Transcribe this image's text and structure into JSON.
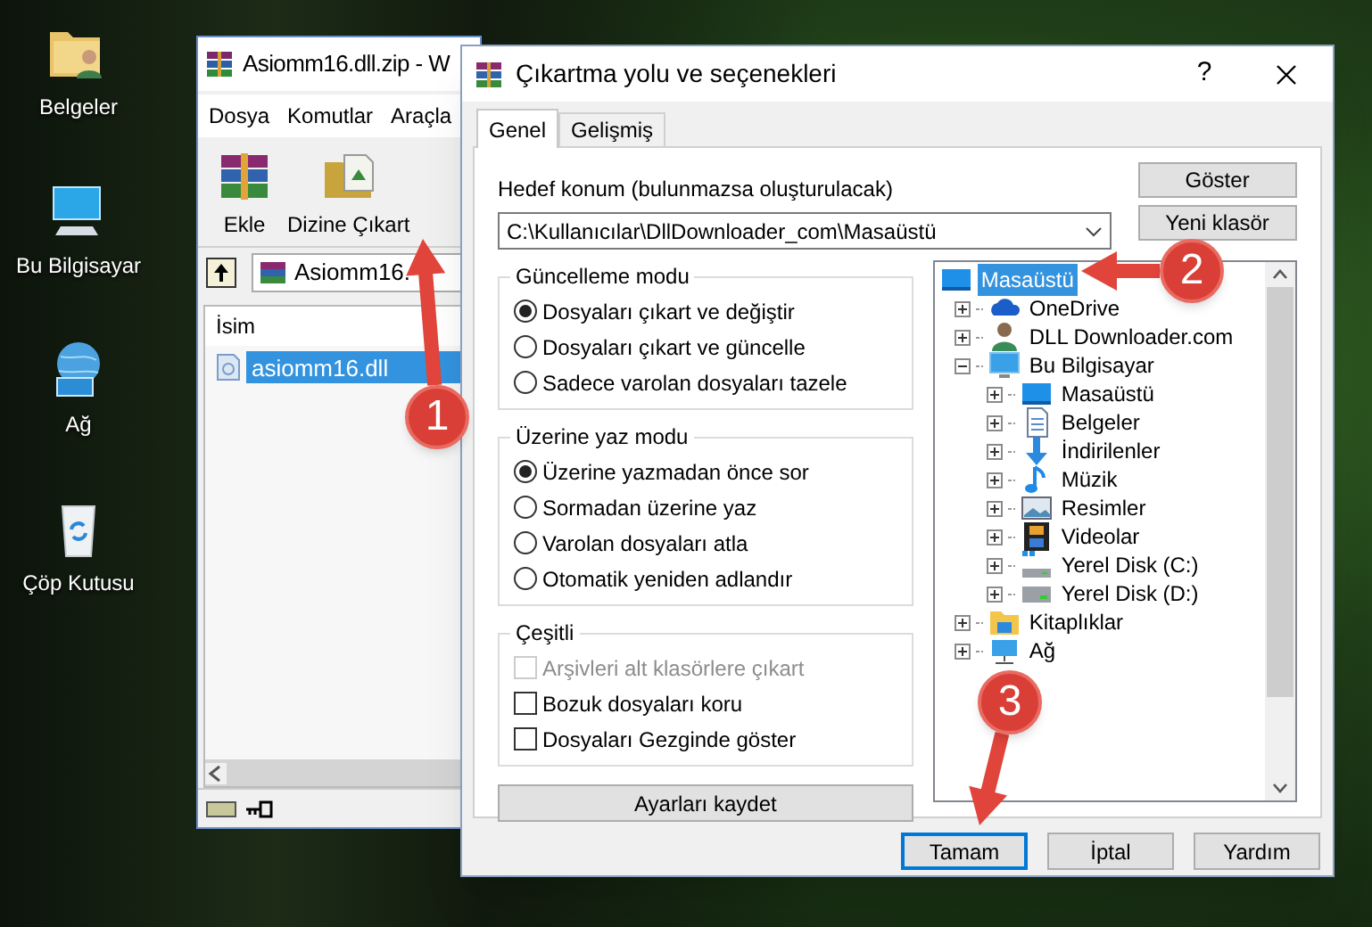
{
  "desktop_icons": [
    {
      "label": "Belgeler",
      "kind": "documents"
    },
    {
      "label": "Bu Bilgisayar",
      "kind": "computer"
    },
    {
      "label": "Ağ",
      "kind": "network"
    },
    {
      "label": "Çöp Kutusu",
      "kind": "recycle"
    }
  ],
  "archive_window": {
    "title": "Asiomm16.dll.zip - W",
    "menu": [
      "Dosya",
      "Komutlar",
      "Araçla"
    ],
    "toolbar": [
      {
        "label": "Ekle",
        "kind": "add"
      },
      {
        "label": "Dizine Çıkart",
        "kind": "extract"
      }
    ],
    "path": "Asiomm16.",
    "columns": [
      "İsim"
    ],
    "files": [
      {
        "name": "asiomm16.dll",
        "selected": true
      }
    ]
  },
  "dialog": {
    "title": "Çıkartma yolu ve seçenekleri",
    "help": "?",
    "tabs": [
      {
        "label": "Genel",
        "selected": true
      },
      {
        "label": "Gelişmiş",
        "selected": false
      }
    ],
    "destination": {
      "label": "Hedef konum (bulunmazsa oluşturulacak)",
      "value": "C:\\Kullanıcılar\\DllDownloader_com\\Masaüstü"
    },
    "side_buttons": [
      "Göster",
      "Yeni klasör"
    ],
    "groups": [
      {
        "title": "Güncelleme modu",
        "options": [
          {
            "kind": "radio",
            "label": "Dosyaları çıkart ve değiştir",
            "selected": true
          },
          {
            "kind": "radio",
            "label": "Dosyaları çıkart ve güncelle",
            "selected": false
          },
          {
            "kind": "radio",
            "label": "Sadece varolan dosyaları tazele",
            "selected": false
          }
        ]
      },
      {
        "title": "Üzerine yaz modu",
        "options": [
          {
            "kind": "radio",
            "label": "Üzerine yazmadan önce sor",
            "selected": true
          },
          {
            "kind": "radio",
            "label": "Sormadan üzerine yaz",
            "selected": false
          },
          {
            "kind": "radio",
            "label": "Varolan dosyaları atla",
            "selected": false
          },
          {
            "kind": "radio",
            "label": "Otomatik yeniden adlandır",
            "selected": false
          }
        ]
      },
      {
        "title": "Çeşitli",
        "options": [
          {
            "kind": "checkbox",
            "label": "Arşivleri alt klasörlere çıkart",
            "checked": false,
            "disabled": true
          },
          {
            "kind": "checkbox",
            "label": "Bozuk dosyaları koru",
            "checked": false,
            "disabled": false
          },
          {
            "kind": "checkbox",
            "label": "Dosyaları Gezginde göster",
            "checked": false,
            "disabled": false
          }
        ]
      }
    ],
    "save_button": "Ayarları kaydet",
    "tree": {
      "label": "Masaüstü",
      "kind": "desktop",
      "selected": true,
      "children": [
        {
          "label": "OneDrive",
          "kind": "cloud",
          "selected": false,
          "expanded": false
        },
        {
          "label": "DLL Downloader.com",
          "kind": "user",
          "selected": false,
          "expanded": false
        },
        {
          "label": "Bu Bilgisayar",
          "kind": "computer",
          "selected": false,
          "expanded": true,
          "children": [
            {
              "label": "Masaüstü",
              "kind": "desktop",
              "selected": false,
              "expanded": false
            },
            {
              "label": "Belgeler",
              "kind": "document",
              "selected": false,
              "expanded": false
            },
            {
              "label": "İndirilenler",
              "kind": "download",
              "selected": false,
              "expanded": false
            },
            {
              "label": "Müzik",
              "kind": "music",
              "selected": false,
              "expanded": false
            },
            {
              "label": "Resimler",
              "kind": "pictures",
              "selected": false,
              "expanded": false
            },
            {
              "label": "Videolar",
              "kind": "video",
              "selected": false,
              "expanded": false
            },
            {
              "label": "Yerel Disk (C:)",
              "kind": "systemdrive",
              "selected": false,
              "expanded": false
            },
            {
              "label": "Yerel Disk (D:)",
              "kind": "drive",
              "selected": false,
              "expanded": false
            }
          ]
        },
        {
          "label": "Kitaplıklar",
          "kind": "library",
          "selected": false,
          "expanded": false
        },
        {
          "label": "Ağ",
          "kind": "network",
          "selected": false,
          "expanded": false
        }
      ]
    },
    "buttons": [
      {
        "label": "Tamam",
        "default": true
      },
      {
        "label": "İptal",
        "default": false
      },
      {
        "label": "Yardım",
        "default": false
      }
    ]
  },
  "callouts": [
    {
      "label": "1"
    },
    {
      "label": "2"
    },
    {
      "label": "3"
    }
  ]
}
